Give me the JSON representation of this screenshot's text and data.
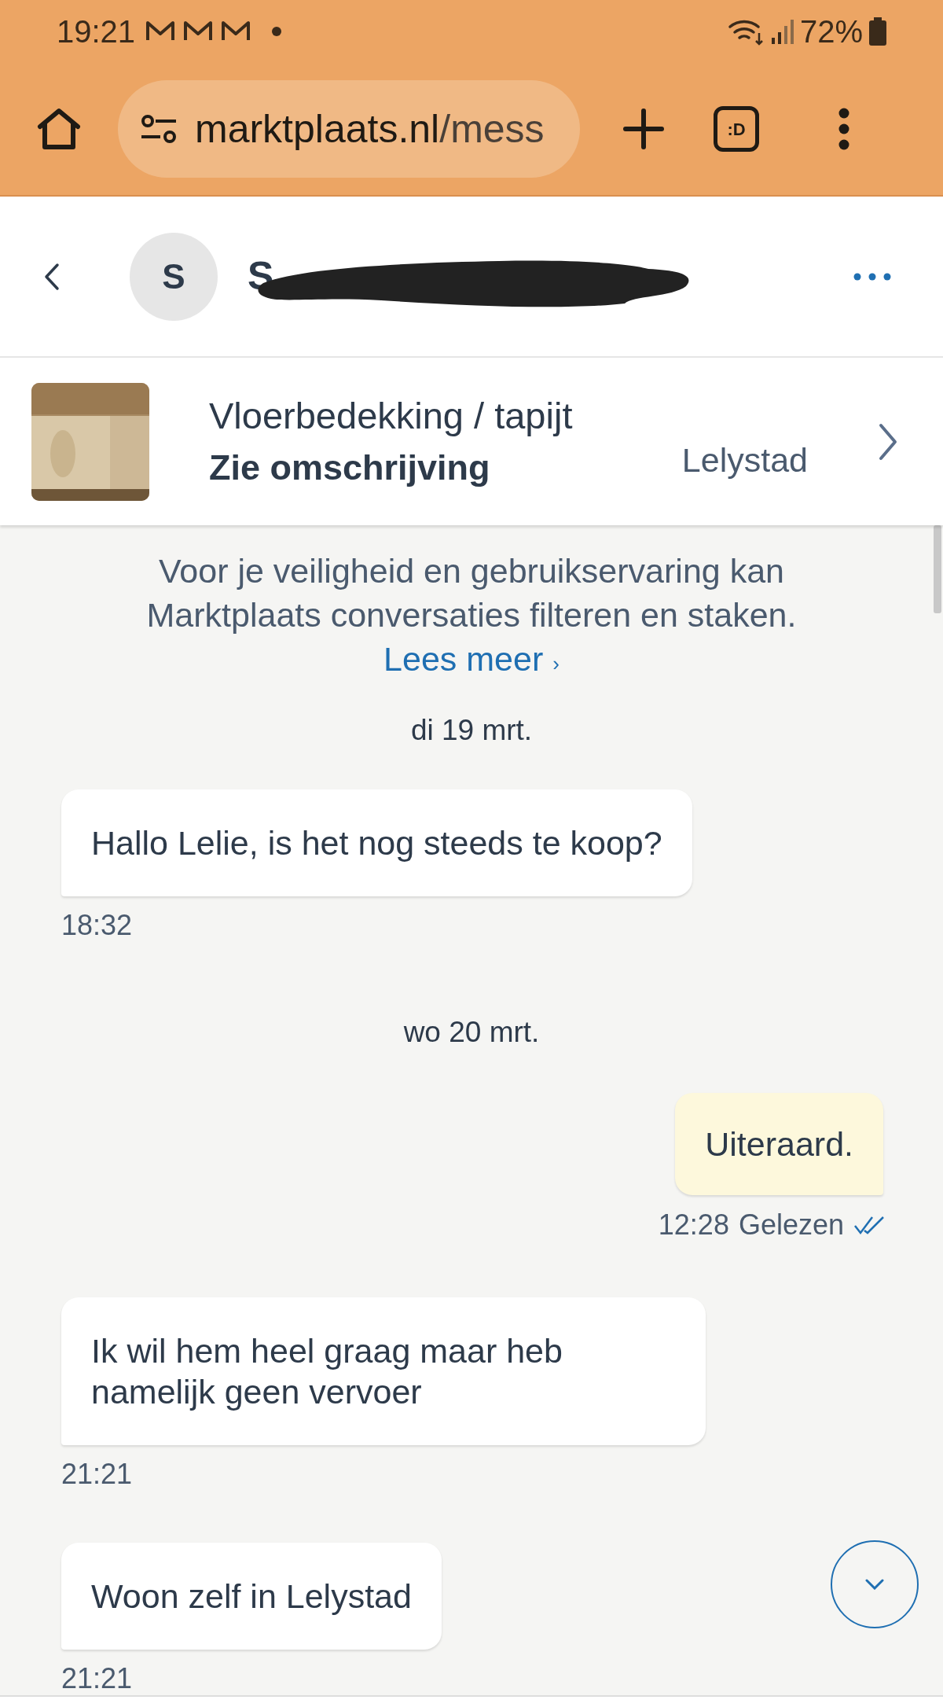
{
  "status_bar": {
    "time": "19:21",
    "battery": "72%"
  },
  "browser": {
    "url_host": "marktplaats.nl",
    "url_path": "/mess",
    "tab_label": ":D"
  },
  "chat_header": {
    "avatar_initial": "S",
    "name": "S",
    "redacted": true
  },
  "listing": {
    "title": "Vloerbedekking / tapijt",
    "subtitle": "Zie omschrijving",
    "location": "Lelystad"
  },
  "notice": {
    "text": "Voor je veiligheid en gebruikservaring kan Marktplaats conversaties filteren en staken.",
    "link": "Lees meer",
    "link_icon": "›"
  },
  "messages": [
    {
      "kind": "date",
      "text": "di 19 mrt."
    },
    {
      "kind": "incoming",
      "text": "Hallo Lelie, is het nog steeds te koop?",
      "time": "18:32"
    },
    {
      "kind": "date",
      "text": "wo 20 mrt."
    },
    {
      "kind": "outgoing",
      "text": "Uiteraard.",
      "time": "12:28",
      "status": "Gelezen",
      "read": true
    },
    {
      "kind": "incoming",
      "text": "Ik wil hem heel graag maar heb namelijk geen vervoer",
      "time": "21:21"
    },
    {
      "kind": "incoming",
      "text": "Woon zelf in Lelystad",
      "time": "21:21"
    }
  ]
}
